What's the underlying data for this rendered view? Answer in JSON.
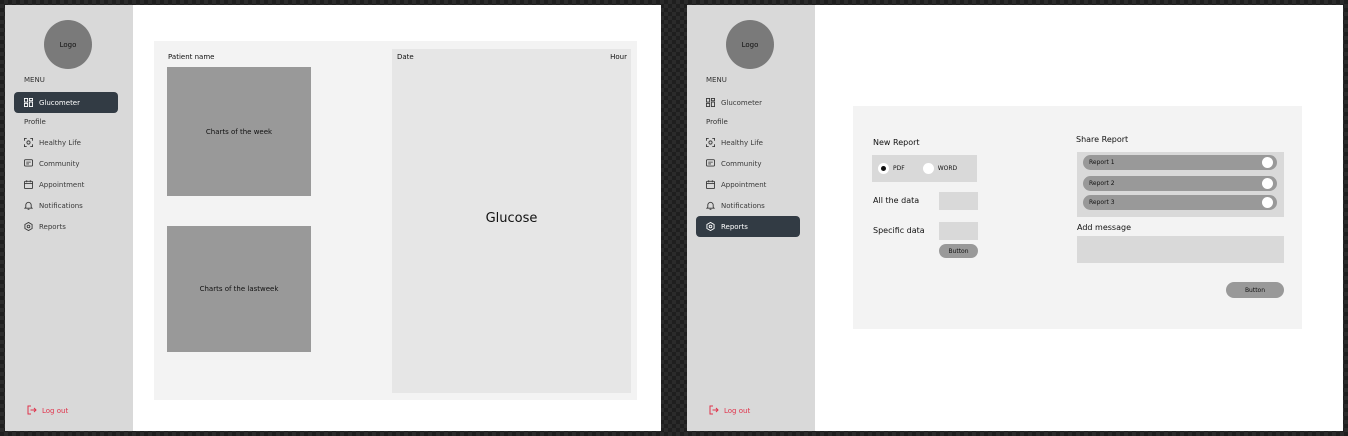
{
  "colors": {
    "sidebar_bg": "#d9d9d9",
    "active_item_bg": "#323b44",
    "logout_color": "#e0344c",
    "placeholder_gray": "#999999"
  },
  "screen1": {
    "logo": "Logo",
    "menu_label": "MENU",
    "profile_label": "Profile",
    "nav": [
      {
        "label": "Glucometer",
        "icon": "grid-icon"
      },
      {
        "label": "Healthy Life",
        "icon": "focus-icon"
      },
      {
        "label": "Community",
        "icon": "chat-icon"
      },
      {
        "label": "Appointment",
        "icon": "calendar-icon"
      },
      {
        "label": "Notifications",
        "icon": "bell-icon"
      },
      {
        "label": "Reports",
        "icon": "settings-icon"
      }
    ],
    "active_nav": "Glucometer",
    "logout": "Log out",
    "patient_name_label": "Patient name",
    "chart_week": "Charts of the week",
    "chart_lastweek": "Charts of the lastweek",
    "glucose_panel": {
      "date_label": "Date",
      "hour_label": "Hour",
      "title": "Glucose"
    }
  },
  "screen2": {
    "logo": "Logo",
    "menu_label": "MENU",
    "profile_label": "Profile",
    "nav": [
      {
        "label": "Glucometer",
        "icon": "grid-icon"
      },
      {
        "label": "Healthy Life",
        "icon": "focus-icon"
      },
      {
        "label": "Community",
        "icon": "chat-icon"
      },
      {
        "label": "Appointment",
        "icon": "calendar-icon"
      },
      {
        "label": "Notifications",
        "icon": "bell-icon"
      },
      {
        "label": "Reports",
        "icon": "settings-icon"
      }
    ],
    "active_nav": "Reports",
    "logout": "Log out",
    "new_report": {
      "title": "New Report",
      "format_options": [
        "PDF",
        "WORD"
      ],
      "selected_format": "PDF",
      "all_data_label": "All the data",
      "specific_data_label": "Specific data",
      "button": "Button"
    },
    "share_report": {
      "title": "Share Report",
      "reports": [
        "Report 1",
        "Report 2",
        "Report 3"
      ]
    },
    "add_message_label": "Add  message",
    "button": "Button"
  }
}
